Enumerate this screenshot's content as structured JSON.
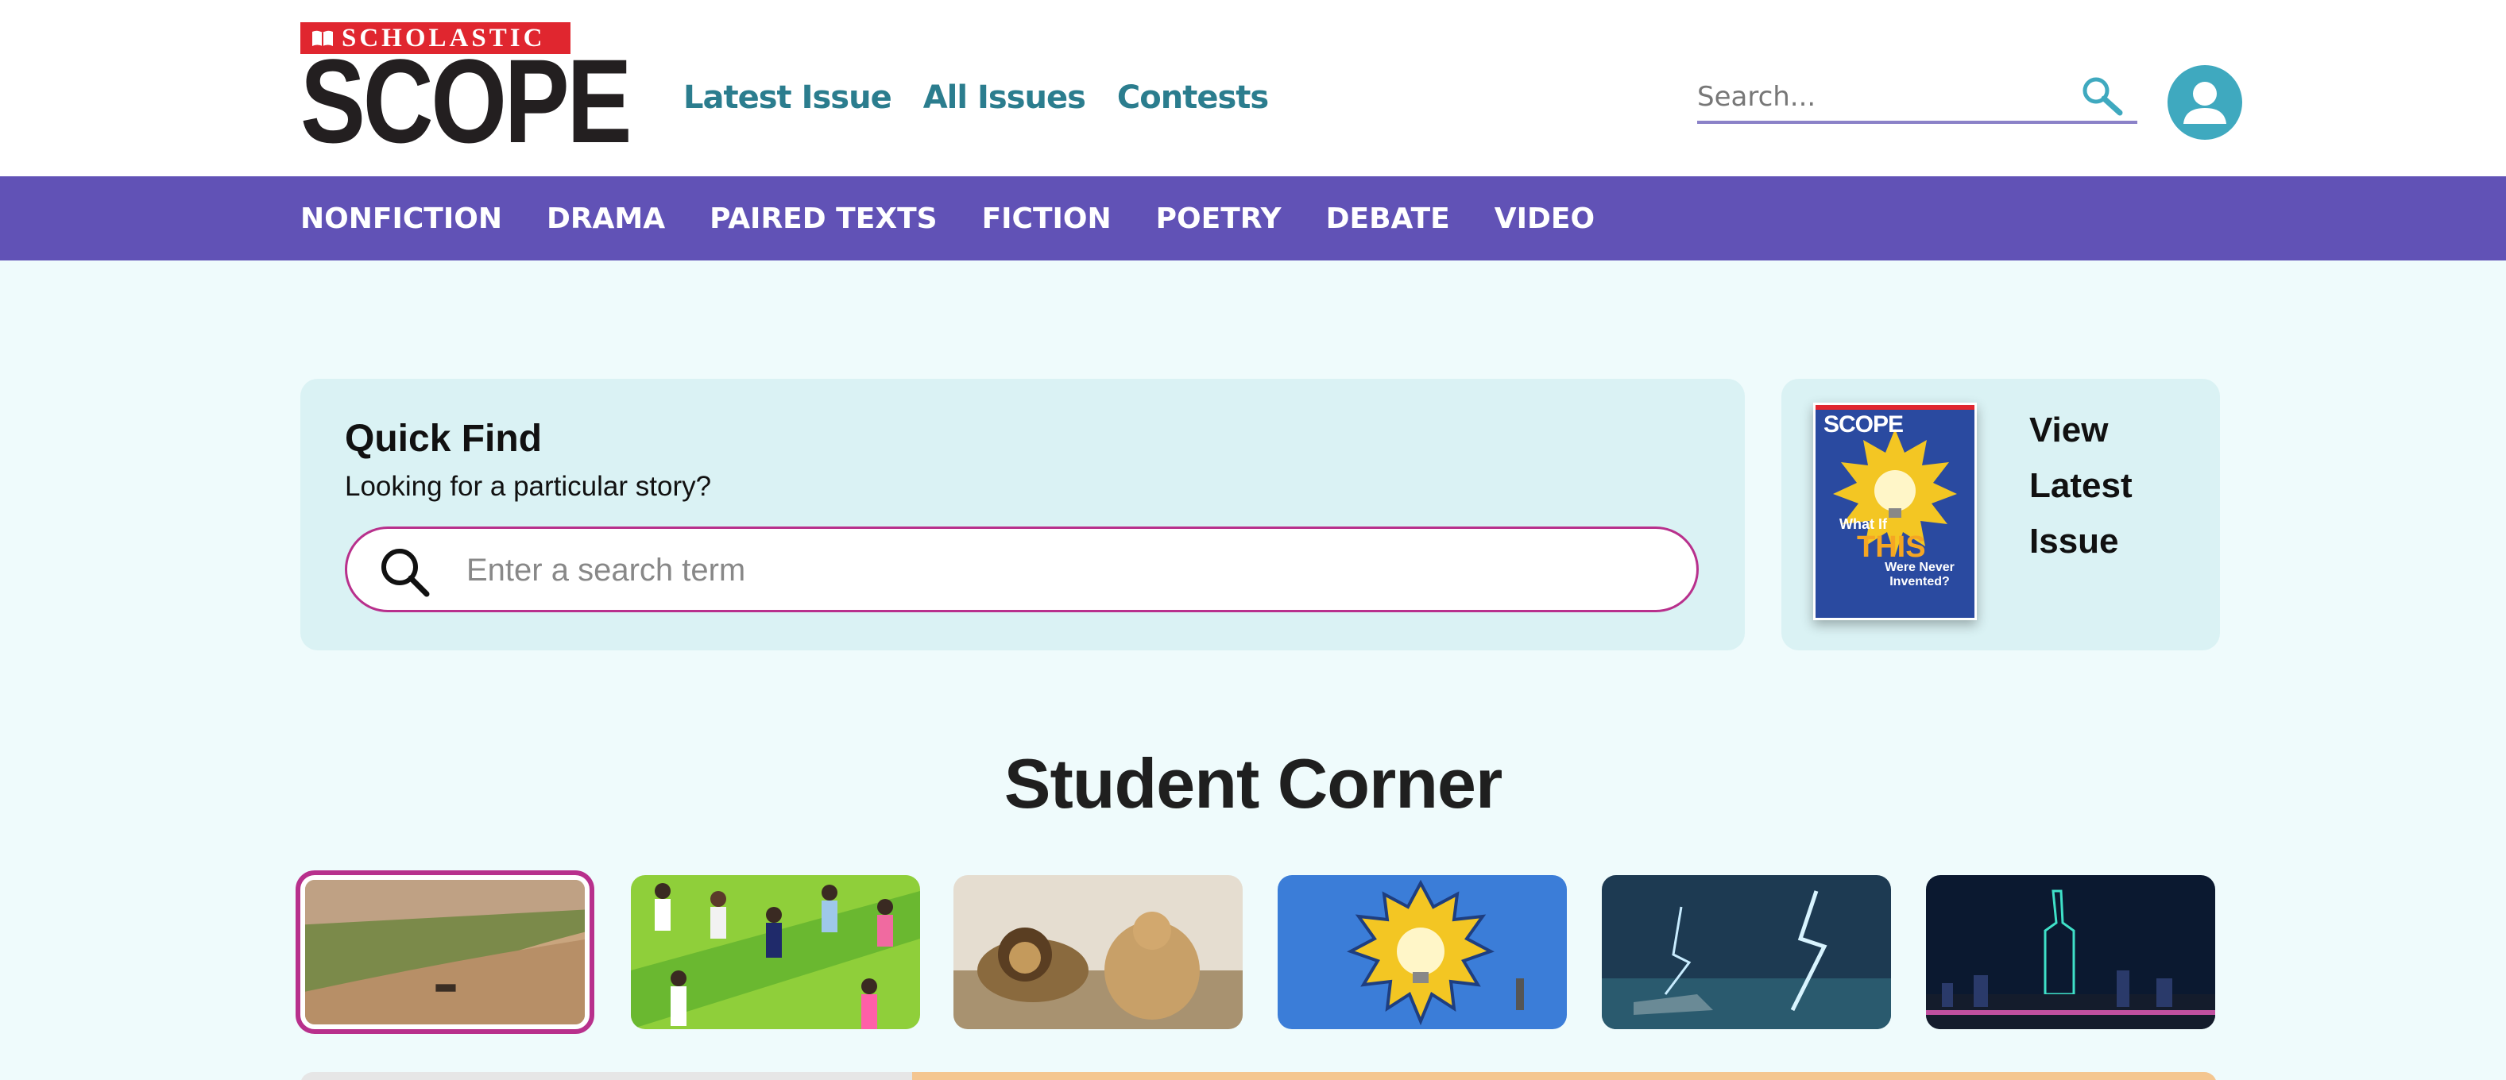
{
  "header": {
    "logo_top": "SCHOLASTIC",
    "logo_main": "SCOPE",
    "nav": [
      "Latest Issue",
      "All Issues",
      "Contests"
    ],
    "search_placeholder": "Search..."
  },
  "categories": [
    "NONFICTION",
    "DRAMA",
    "PAIRED TEXTS",
    "FICTION",
    "POETRY",
    "DEBATE",
    "VIDEO"
  ],
  "quick_find": {
    "title": "Quick Find",
    "subtitle": "Looking for a particular story?",
    "placeholder": "Enter a search term"
  },
  "latest_issue": {
    "label": "View Latest Issue",
    "cover": {
      "masthead": "SCOPE",
      "line1": "What If",
      "line2": "THIS",
      "line3": "Were Never Invented?"
    }
  },
  "student_corner": {
    "title": "Student Corner",
    "items": [
      {
        "name": "river-boat-thumbnail",
        "selected": true
      },
      {
        "name": "soccer-players-thumbnail",
        "selected": false
      },
      {
        "name": "lions-thumbnail",
        "selected": false
      },
      {
        "name": "lightbulb-thumbnail",
        "selected": false
      },
      {
        "name": "storm-lightning-thumbnail",
        "selected": false
      },
      {
        "name": "city-drone-show-thumbnail",
        "selected": false
      }
    ]
  },
  "colors": {
    "purple_nav": "#6152b6",
    "teal_link": "#2b7d8e",
    "magenta_accent": "#b8308c",
    "page_bg": "#effbfc",
    "card_bg": "#daf2f4",
    "logo_red": "#e0262f"
  }
}
